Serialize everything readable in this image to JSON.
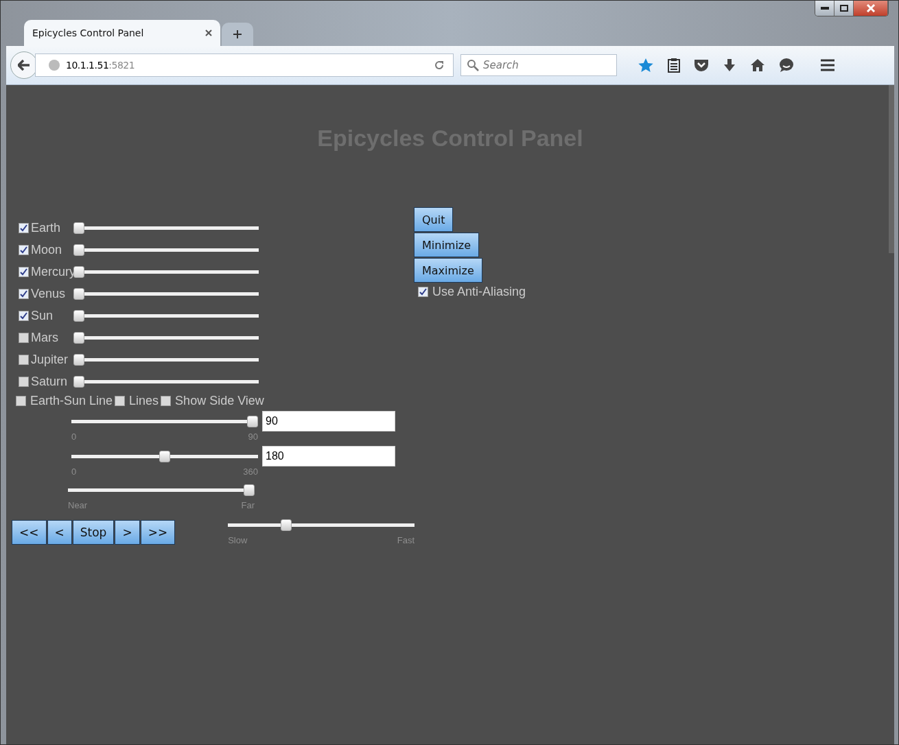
{
  "browser": {
    "tab_title": "Epicycles Control Panel",
    "url_host": "10.1.1.51",
    "url_port": ":5821",
    "search_placeholder": "Search"
  },
  "page": {
    "heading": "Epicycles Control Panel",
    "planets": [
      {
        "label": "Earth",
        "checked": true,
        "level": 0
      },
      {
        "label": "Moon",
        "checked": true,
        "level": 0
      },
      {
        "label": "Mercury",
        "checked": true,
        "level": 0
      },
      {
        "label": "Venus",
        "checked": true,
        "level": 0
      },
      {
        "label": "Sun",
        "checked": true,
        "level": 0
      },
      {
        "label": "Mars",
        "checked": false,
        "level": 0
      },
      {
        "label": "Jupiter",
        "checked": false,
        "level": 0
      },
      {
        "label": "Saturn",
        "checked": false,
        "level": 0
      }
    ],
    "options": [
      {
        "label": "Earth-Sun Line",
        "checked": false
      },
      {
        "label": "Lines",
        "checked": false
      },
      {
        "label": "Show Side View",
        "checked": false
      }
    ],
    "range_sliders": [
      {
        "level": 1,
        "min_label": "0",
        "max_label": "90",
        "value": "90"
      },
      {
        "level": 0.5,
        "min_label": "0",
        "max_label": "360",
        "value": "180"
      },
      {
        "level": 1,
        "min_label": "Near",
        "max_label": "Far"
      }
    ],
    "playback_buttons": [
      "<<",
      "<",
      "Stop",
      ">",
      ">>"
    ],
    "speed": {
      "level": 0.3,
      "min_label": "Slow",
      "max_label": "Fast"
    },
    "window_buttons": [
      "Quit",
      "Minimize",
      "Maximize"
    ],
    "anti_aliasing": {
      "label": "Use Anti-Aliasing",
      "checked": true
    }
  }
}
